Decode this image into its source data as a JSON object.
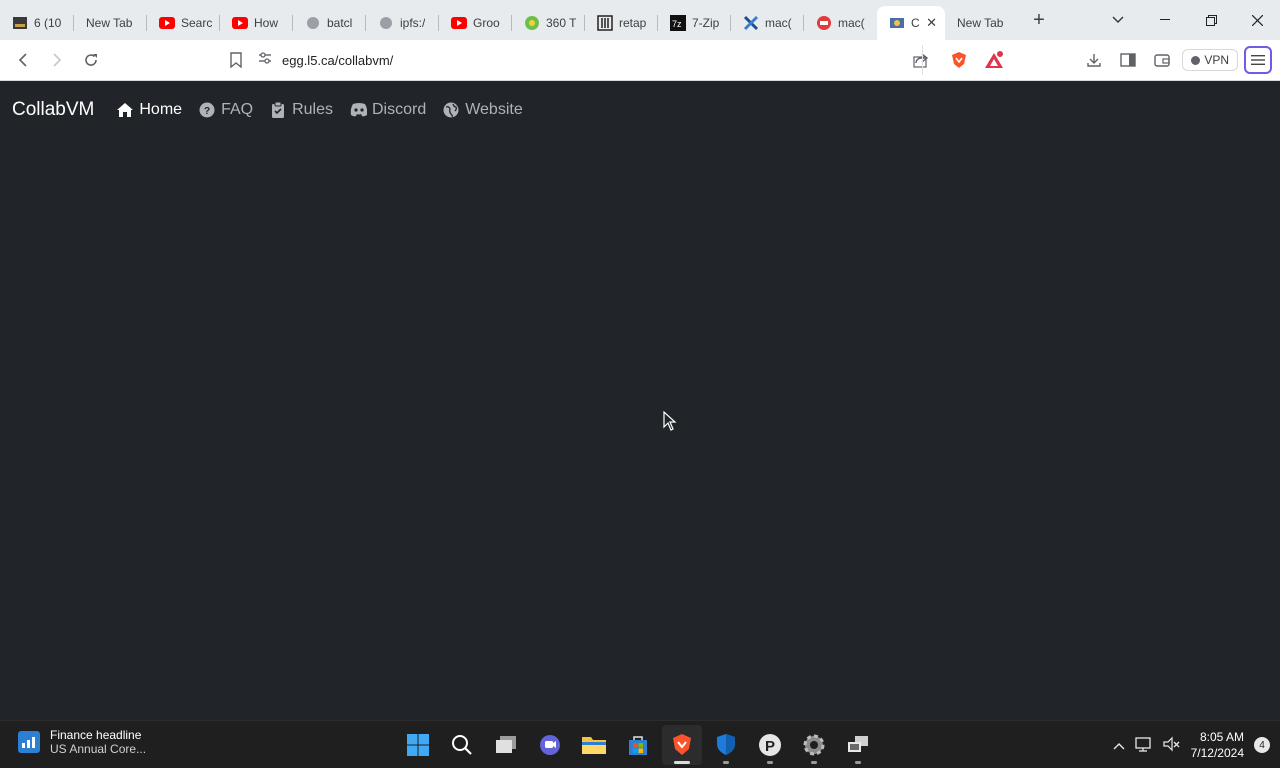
{
  "browser": {
    "tabs": [
      {
        "title": "6 (10",
        "icon": "dark-square-icon"
      },
      {
        "title": "New Tab",
        "icon": ""
      },
      {
        "title": "Searc",
        "icon": "youtube-icon"
      },
      {
        "title": "How",
        "icon": "youtube-icon"
      },
      {
        "title": "batcl",
        "icon": "globe-icon"
      },
      {
        "title": "ipfs:/",
        "icon": "globe-icon"
      },
      {
        "title": "Groo",
        "icon": "youtube-icon"
      },
      {
        "title": "360 T",
        "icon": "green-circle-icon"
      },
      {
        "title": "retap",
        "icon": "archive-icon"
      },
      {
        "title": "7-Zip",
        "icon": "7zip-icon"
      },
      {
        "title": "mac(",
        "icon": "x-icon"
      },
      {
        "title": "mac(",
        "icon": "red-circle-icon"
      },
      {
        "title": "C",
        "icon": "collabvm-icon",
        "active": true
      },
      {
        "title": "New Tab",
        "icon": ""
      }
    ],
    "address": "egg.l5.ca/collabvm/",
    "vpn_label": "VPN",
    "brave_badge": "1"
  },
  "page": {
    "brand": "CollabVM",
    "nav": [
      {
        "label": "Home",
        "icon": "home-icon",
        "active": true
      },
      {
        "label": "FAQ",
        "icon": "question-circle-icon"
      },
      {
        "label": "Rules",
        "icon": "clipboard-check-icon"
      },
      {
        "label": "Discord",
        "icon": "discord-icon"
      },
      {
        "label": "Website",
        "icon": "globe-icon"
      }
    ]
  },
  "taskbar": {
    "widget_title": "Finance headline",
    "widget_subtitle": "US Annual Core...",
    "time": "8:05 AM",
    "date": "7/12/2024",
    "notification_count": "4"
  },
  "colors": {
    "page_background": "#212529",
    "nav_text": "#aeb3b8",
    "nav_active": "#ffffff"
  }
}
